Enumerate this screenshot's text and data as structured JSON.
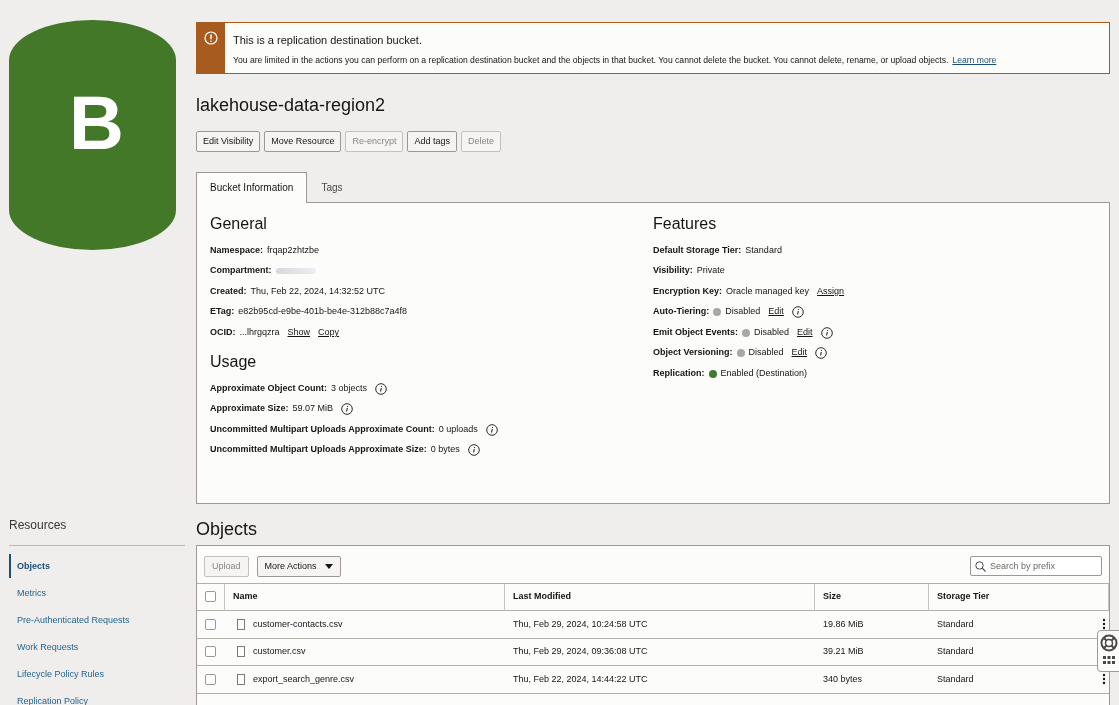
{
  "bucket_icon": {
    "letter": "B"
  },
  "alert": {
    "title": "This is a replication destination bucket.",
    "message": "You are limited in the actions you can perform on a replication destination bucket and the objects in that bucket. You cannot delete the bucket. You cannot delete, rename, or upload objects.",
    "link": "Learn more"
  },
  "title": "lakehouse-data-region2",
  "actions": [
    {
      "label": "Edit Visibility",
      "disabled": false
    },
    {
      "label": "Move Resource",
      "disabled": false
    },
    {
      "label": "Re-encrypt",
      "disabled": true
    },
    {
      "label": "Add tags",
      "disabled": false
    },
    {
      "label": "Delete",
      "disabled": true
    }
  ],
  "tabs": [
    {
      "label": "Bucket Information",
      "selected": true
    },
    {
      "label": "Tags",
      "selected": false
    }
  ],
  "sections": [
    {
      "heading": "General",
      "items": [
        {
          "label": "Namespace:",
          "value": "frqap2zhtzbe"
        },
        {
          "label": "Compartment:",
          "redacted": true
        },
        {
          "label": "Created:",
          "value": "Thu, Feb 22, 2024, 14:32:52 UTC"
        },
        {
          "label": "ETag:",
          "value": "e82b95cd-e9be-401b-be4e-312b88c7a4f8"
        },
        {
          "label": "OCID:",
          "value": "...lhrgqzra",
          "links": [
            "Show",
            "Copy"
          ]
        }
      ]
    },
    {
      "heading": "Usage",
      "items": [
        {
          "label": "Approximate Object Count:",
          "value": "3 objects",
          "info": true
        },
        {
          "label": "Approximate Size:",
          "value": "59.07 MiB",
          "info": true
        },
        {
          "label": "Uncommitted Multipart Uploads Approximate Count:",
          "value": "0 uploads",
          "info": true
        },
        {
          "label": "Uncommitted Multipart Uploads Approximate Size:",
          "value": "0 bytes",
          "info": true
        }
      ]
    },
    {
      "heading": "Features",
      "items": [
        {
          "label": "Default Storage Tier:",
          "value": "Standard"
        },
        {
          "label": "Visibility:",
          "value": "Private"
        },
        {
          "label": "Encryption Key:",
          "value": "Oracle managed key",
          "links": [
            "Assign"
          ]
        },
        {
          "label": "Auto-Tiering:",
          "color": "#aaa7a3",
          "value": "Disabled",
          "links": [
            "Edit"
          ],
          "info": true
        },
        {
          "label": "Emit Object Events:",
          "color": "#aaa7a3",
          "value": "Disabled",
          "links": [
            "Edit"
          ],
          "info": true
        },
        {
          "label": "Object Versioning:",
          "color": "#aaa7a3",
          "value": "Disabled",
          "links": [
            "Edit"
          ],
          "info": true
        },
        {
          "label": "Replication:",
          "color": "#3f7a2a",
          "value": "Enabled (Destination)"
        }
      ]
    }
  ],
  "resources": {
    "heading": "Resources",
    "items": [
      {
        "label": "Objects",
        "selected": true
      },
      {
        "label": "Metrics",
        "selected": false
      },
      {
        "label": "Pre-Authenticated Requests",
        "selected": false
      },
      {
        "label": "Work Requests",
        "selected": false
      },
      {
        "label": "Lifecycle Policy Rules",
        "selected": false
      },
      {
        "label": "Replication Policy",
        "selected": false
      }
    ]
  },
  "objects": {
    "heading": "Objects",
    "toolbar": [
      {
        "label": "Upload",
        "disabled": true,
        "dropdown": false
      },
      {
        "label": "More Actions",
        "disabled": false,
        "dropdown": true
      }
    ],
    "search": {
      "placeholder": "Search by prefix"
    },
    "select_all_checked": false,
    "columns": [
      "Name",
      "Last Modified",
      "Size",
      "Storage Tier"
    ],
    "rows": [
      {
        "checked": false,
        "name": "customer-contacts.csv",
        "modified": "Thu, Feb 29, 2024, 10:24:58 UTC",
        "size": "19.86 MiB",
        "tier": "Standard",
        "menu": true
      },
      {
        "checked": false,
        "name": "customer.csv",
        "modified": "Thu, Feb 29, 2024, 09:36:08 UTC",
        "size": "39.21 MiB",
        "tier": "Standard",
        "menu": false
      },
      {
        "checked": false,
        "name": "export_search_genre.csv",
        "modified": "Thu, Feb 22, 2024, 14:44:22 UTC",
        "size": "340 bytes",
        "tier": "Standard",
        "menu": true
      }
    ]
  }
}
